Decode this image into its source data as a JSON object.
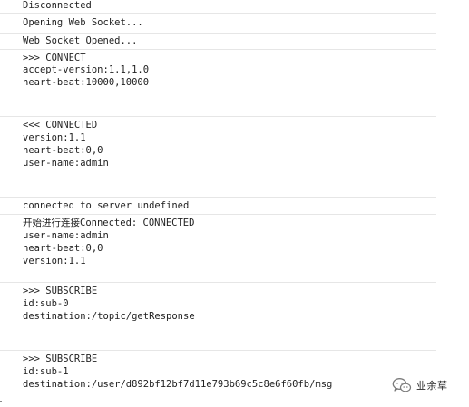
{
  "console": {
    "entries": [
      {
        "lines": [
          "Disconnected"
        ]
      },
      {
        "lines": [
          "Opening Web Socket..."
        ]
      },
      {
        "lines": [
          "Web Socket Opened..."
        ]
      },
      {
        "lines": [
          ">>> CONNECT",
          "accept-version:1.1,1.0",
          "heart-beat:10000,10000"
        ]
      },
      {
        "lines": [
          "<<< CONNECTED",
          "version:1.1",
          "heart-beat:0,0",
          "user-name:admin"
        ]
      },
      {
        "lines": [
          "connected to server undefined"
        ]
      },
      {
        "lines": [
          "开始进行连接Connected: CONNECTED",
          "user-name:admin",
          "heart-beat:0,0",
          "version:1.1"
        ]
      },
      {
        "lines": [
          ">>> SUBSCRIBE",
          "id:sub-0",
          "destination:/topic/getResponse"
        ]
      },
      {
        "lines": [
          ">>> SUBSCRIBE",
          "id:sub-1",
          "destination:/user/d892bf12bf7d11e793b69c5c8e6f60fb/msg"
        ]
      }
    ]
  },
  "watermark": {
    "text": "业余草",
    "icon": "wechat-icon"
  }
}
